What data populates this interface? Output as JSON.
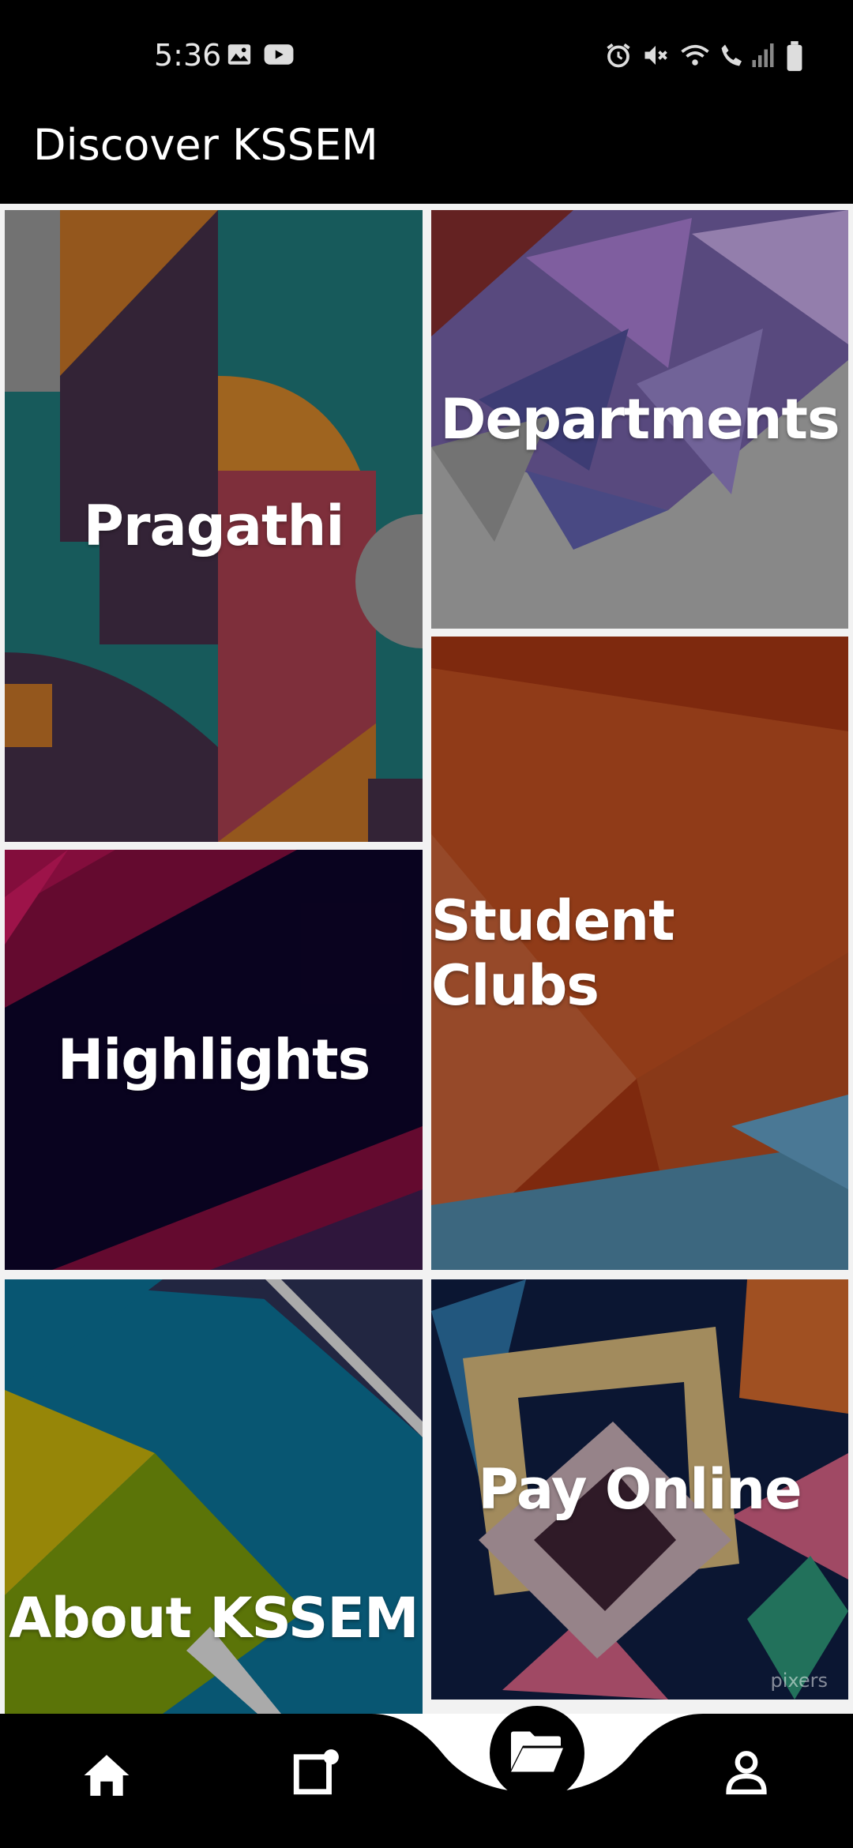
{
  "status_bar": {
    "time": "5:36",
    "icons": [
      "image-icon",
      "youtube-icon",
      "alarm-icon",
      "mute-icon",
      "wifi-icon",
      "wifi-call-icon",
      "signal-icon",
      "battery-icon"
    ]
  },
  "app_bar": {
    "title": "Discover KSSEM"
  },
  "tiles": {
    "pragathi": {
      "label": "Pragathi"
    },
    "departments": {
      "label": "Departments"
    },
    "highlights": {
      "label": "Highlights"
    },
    "student_clubs": {
      "label": "Student Clubs"
    },
    "about": {
      "label": "About KSSEM"
    },
    "pay_online": {
      "label": "Pay Online",
      "watermark": "pixers"
    }
  },
  "bottom_nav": {
    "items": [
      "home-icon",
      "notifications-icon",
      "folder-icon",
      "profile-icon"
    ],
    "active": "folder-icon"
  },
  "colors": {
    "background": "#000000",
    "text": "#ffffff",
    "grid_gap": "#f2f2f2"
  }
}
